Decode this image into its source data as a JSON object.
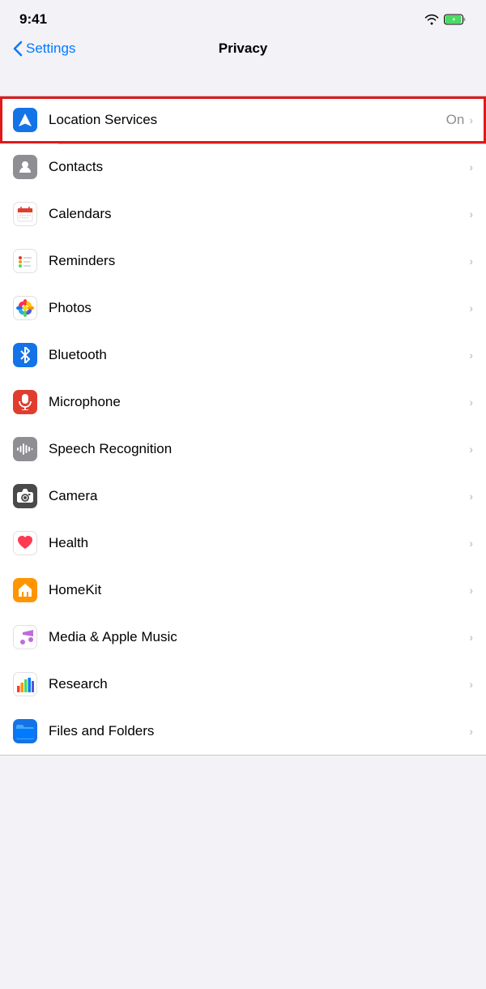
{
  "statusBar": {
    "time": "9:41",
    "icons": [
      "wifi",
      "battery-charging"
    ]
  },
  "navBar": {
    "backLabel": "Settings",
    "title": "Privacy"
  },
  "rows": [
    {
      "id": "location-services",
      "label": "Location Services",
      "value": "On",
      "iconType": "location",
      "iconChar": "arrow",
      "highlighted": true
    },
    {
      "id": "contacts",
      "label": "Contacts",
      "value": "",
      "iconType": "contacts",
      "iconChar": "person"
    },
    {
      "id": "calendars",
      "label": "Calendars",
      "value": "",
      "iconType": "calendars",
      "iconChar": "calendar"
    },
    {
      "id": "reminders",
      "label": "Reminders",
      "value": "",
      "iconType": "reminders",
      "iconChar": "reminders"
    },
    {
      "id": "photos",
      "label": "Photos",
      "value": "",
      "iconType": "photos",
      "iconChar": "photos"
    },
    {
      "id": "bluetooth",
      "label": "Bluetooth",
      "value": "",
      "iconType": "bluetooth",
      "iconChar": "bluetooth"
    },
    {
      "id": "microphone",
      "label": "Microphone",
      "value": "",
      "iconType": "microphone",
      "iconChar": "mic"
    },
    {
      "id": "speech-recognition",
      "label": "Speech Recognition",
      "value": "",
      "iconType": "speech",
      "iconChar": "wave"
    },
    {
      "id": "camera",
      "label": "Camera",
      "value": "",
      "iconType": "camera",
      "iconChar": "camera"
    },
    {
      "id": "health",
      "label": "Health",
      "value": "",
      "iconType": "health",
      "iconChar": "heart"
    },
    {
      "id": "homekit",
      "label": "HomeKit",
      "value": "",
      "iconType": "homekit",
      "iconChar": "home"
    },
    {
      "id": "media-apple-music",
      "label": "Media & Apple Music",
      "value": "",
      "iconType": "music",
      "iconChar": "music"
    },
    {
      "id": "research",
      "label": "Research",
      "value": "",
      "iconType": "research",
      "iconChar": "research"
    },
    {
      "id": "files-and-folders",
      "label": "Files and Folders",
      "value": "",
      "iconType": "files",
      "iconChar": "folder"
    }
  ]
}
